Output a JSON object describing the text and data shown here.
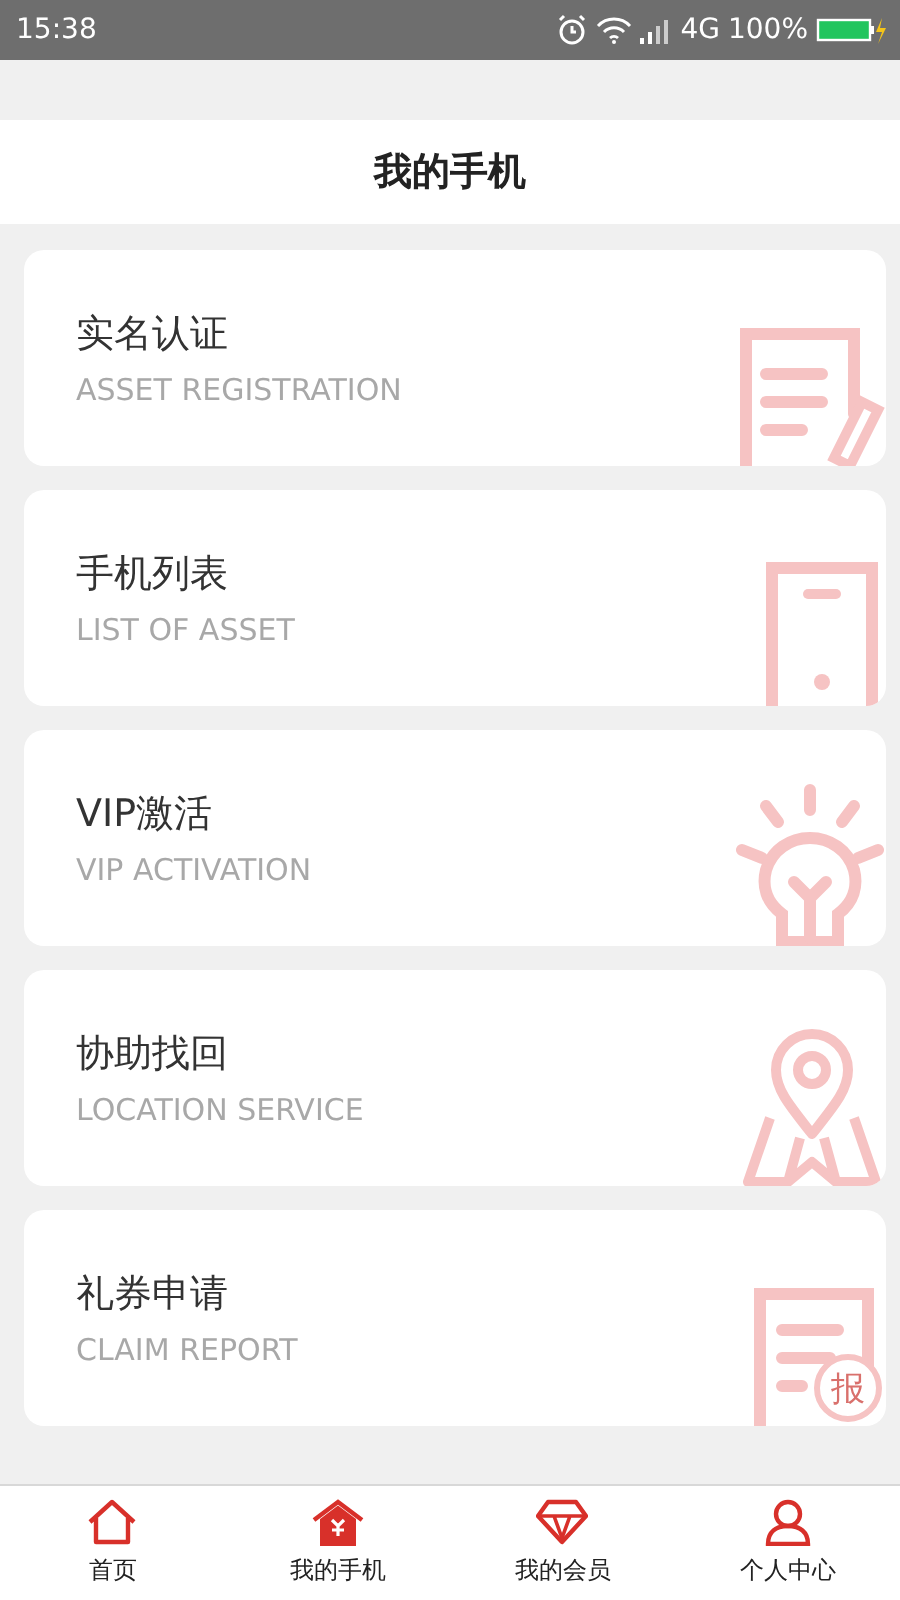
{
  "status_bar": {
    "time": "15:38",
    "network": "4G",
    "battery": "100%"
  },
  "header": {
    "title": "我的手机"
  },
  "cards": [
    {
      "kind": "form",
      "title": "实名认证",
      "subtitle": "ASSET REGISTRATION"
    },
    {
      "kind": "phone",
      "title": "手机列表",
      "subtitle": "LIST OF ASSET"
    },
    {
      "kind": "bulb",
      "title": "VIP激活",
      "subtitle": "VIP ACTIVATION"
    },
    {
      "kind": "map",
      "title": "协助找回",
      "subtitle": "LOCATION SERVICE"
    },
    {
      "kind": "report",
      "title": "礼券申请",
      "subtitle": "CLAIM REPORT",
      "icon_text": "报"
    }
  ],
  "tabs": [
    {
      "kind": "home",
      "label": "首页",
      "selected": false
    },
    {
      "kind": "phone",
      "label": "我的手机",
      "selected": true
    },
    {
      "kind": "member",
      "label": "我的会员",
      "selected": false
    },
    {
      "kind": "person",
      "label": "个人中心",
      "selected": false
    }
  ]
}
